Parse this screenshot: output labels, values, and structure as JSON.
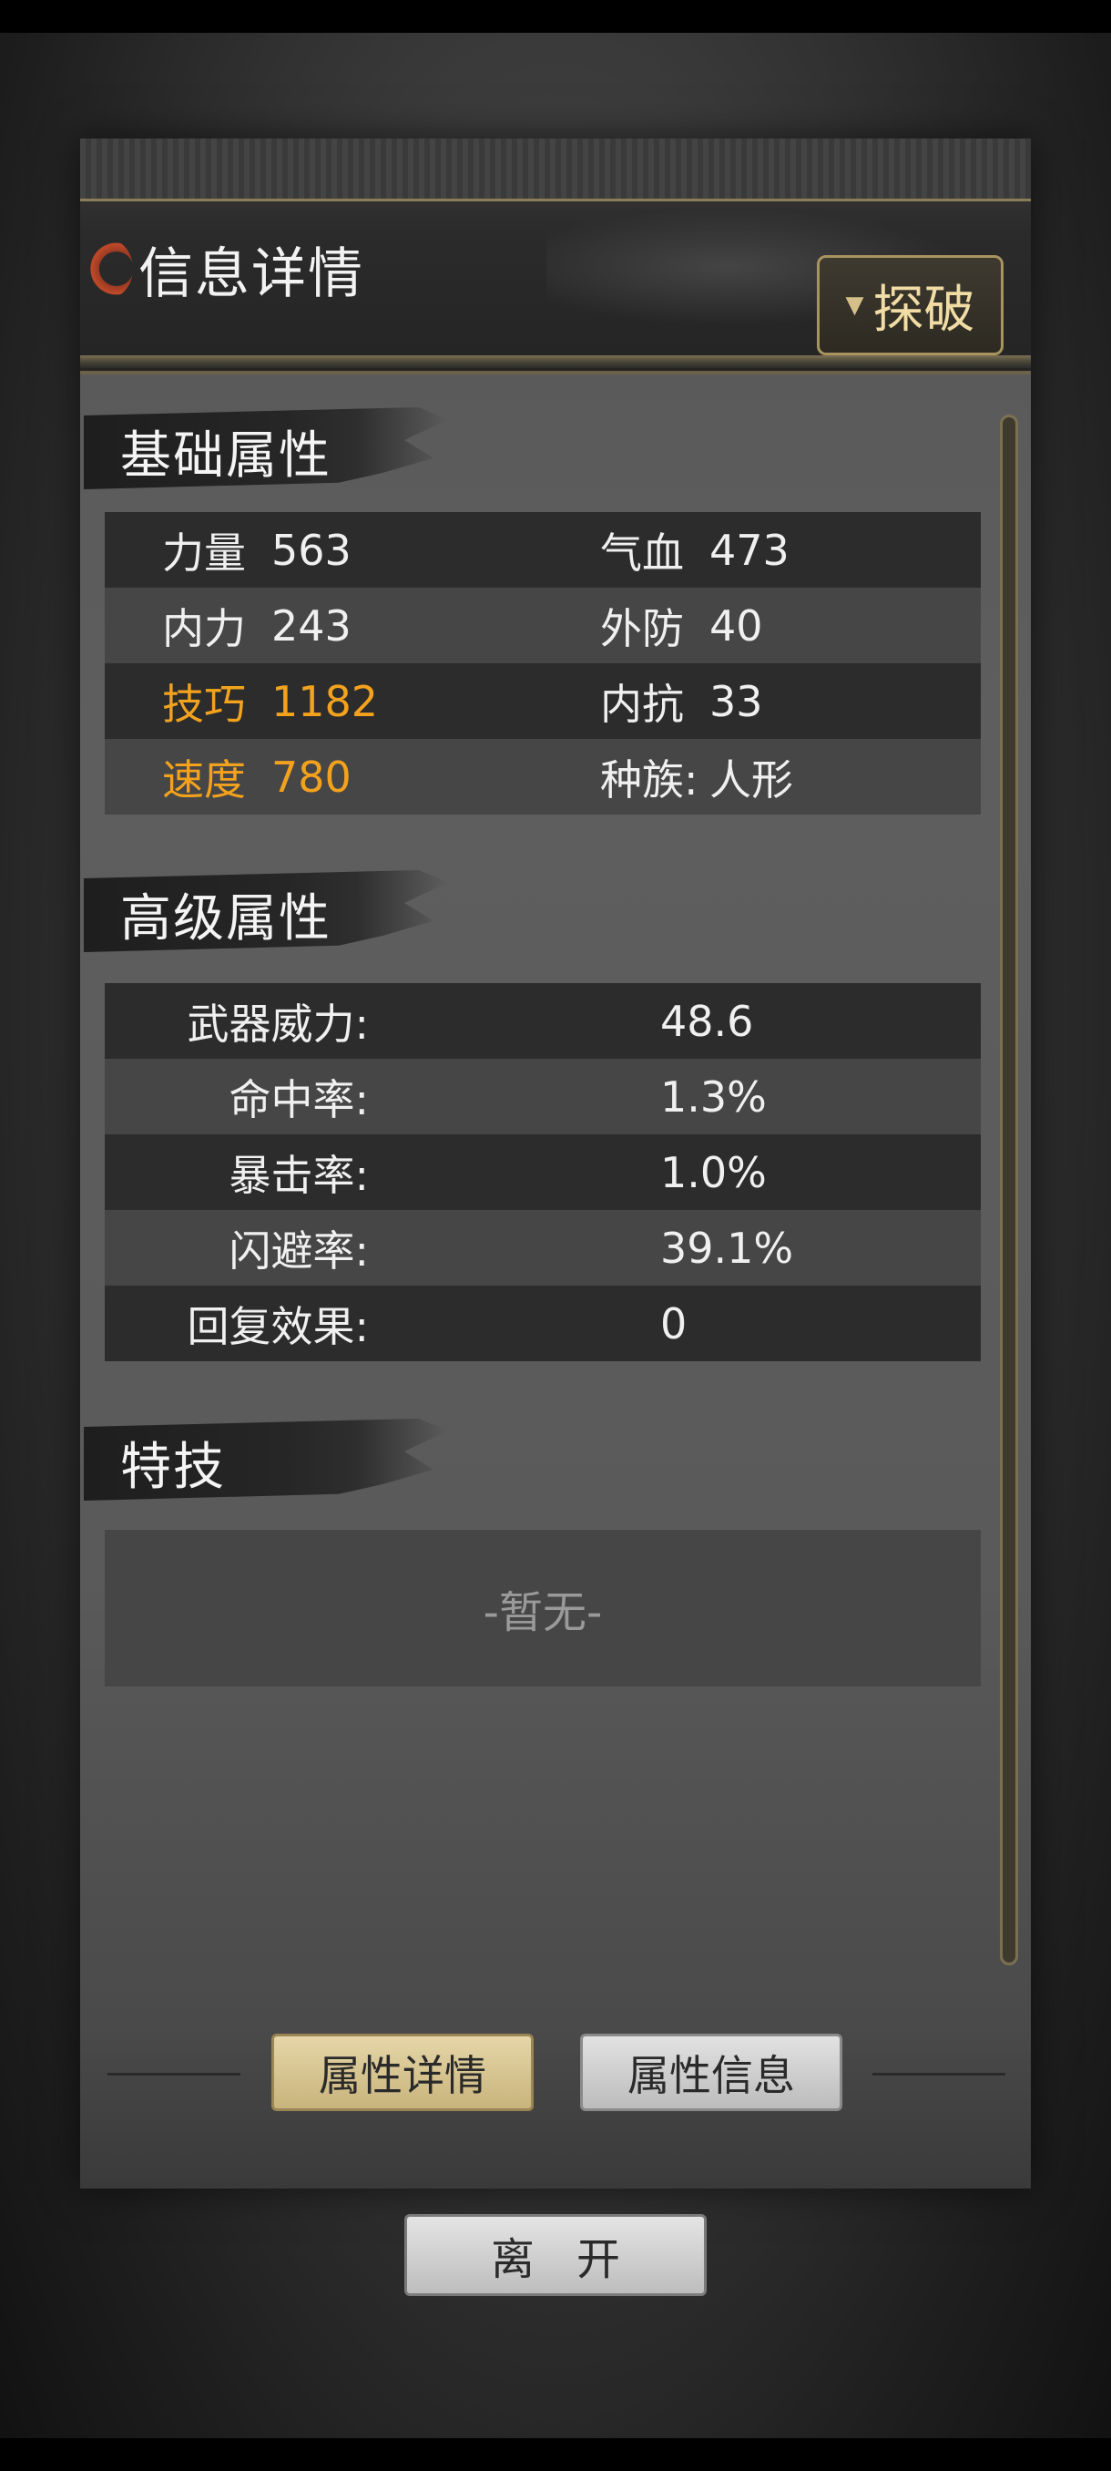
{
  "header": {
    "title": "信息详情",
    "tanpo_button": "探破"
  },
  "basic": {
    "title": "基础属性",
    "rows": [
      {
        "l_label": "力量",
        "l_value": "563",
        "r_label": "气血",
        "r_value": "473"
      },
      {
        "l_label": "内力",
        "l_value": "243",
        "r_label": "外防",
        "r_value": "40"
      },
      {
        "l_label": "技巧",
        "l_value": "1182",
        "r_label": "内抗",
        "r_value": "33"
      },
      {
        "l_label": "速度",
        "l_value": "780",
        "r_label": "种族:",
        "r_value": "人形"
      }
    ],
    "highlight_color": "#f3a21e"
  },
  "advanced": {
    "title": "高级属性",
    "rows": [
      {
        "label": "武器威力:",
        "value": "48.6"
      },
      {
        "label": "命中率:",
        "value": "1.3%"
      },
      {
        "label": "暴击率:",
        "value": "1.0%"
      },
      {
        "label": "闪避率:",
        "value": "39.1%"
      },
      {
        "label": "回复效果:",
        "value": "0"
      }
    ]
  },
  "skills": {
    "title": "特技",
    "empty_text": "-暂无-"
  },
  "tabs": {
    "active": "属性详情",
    "inactive": "属性信息"
  },
  "leave_button": "离开"
}
